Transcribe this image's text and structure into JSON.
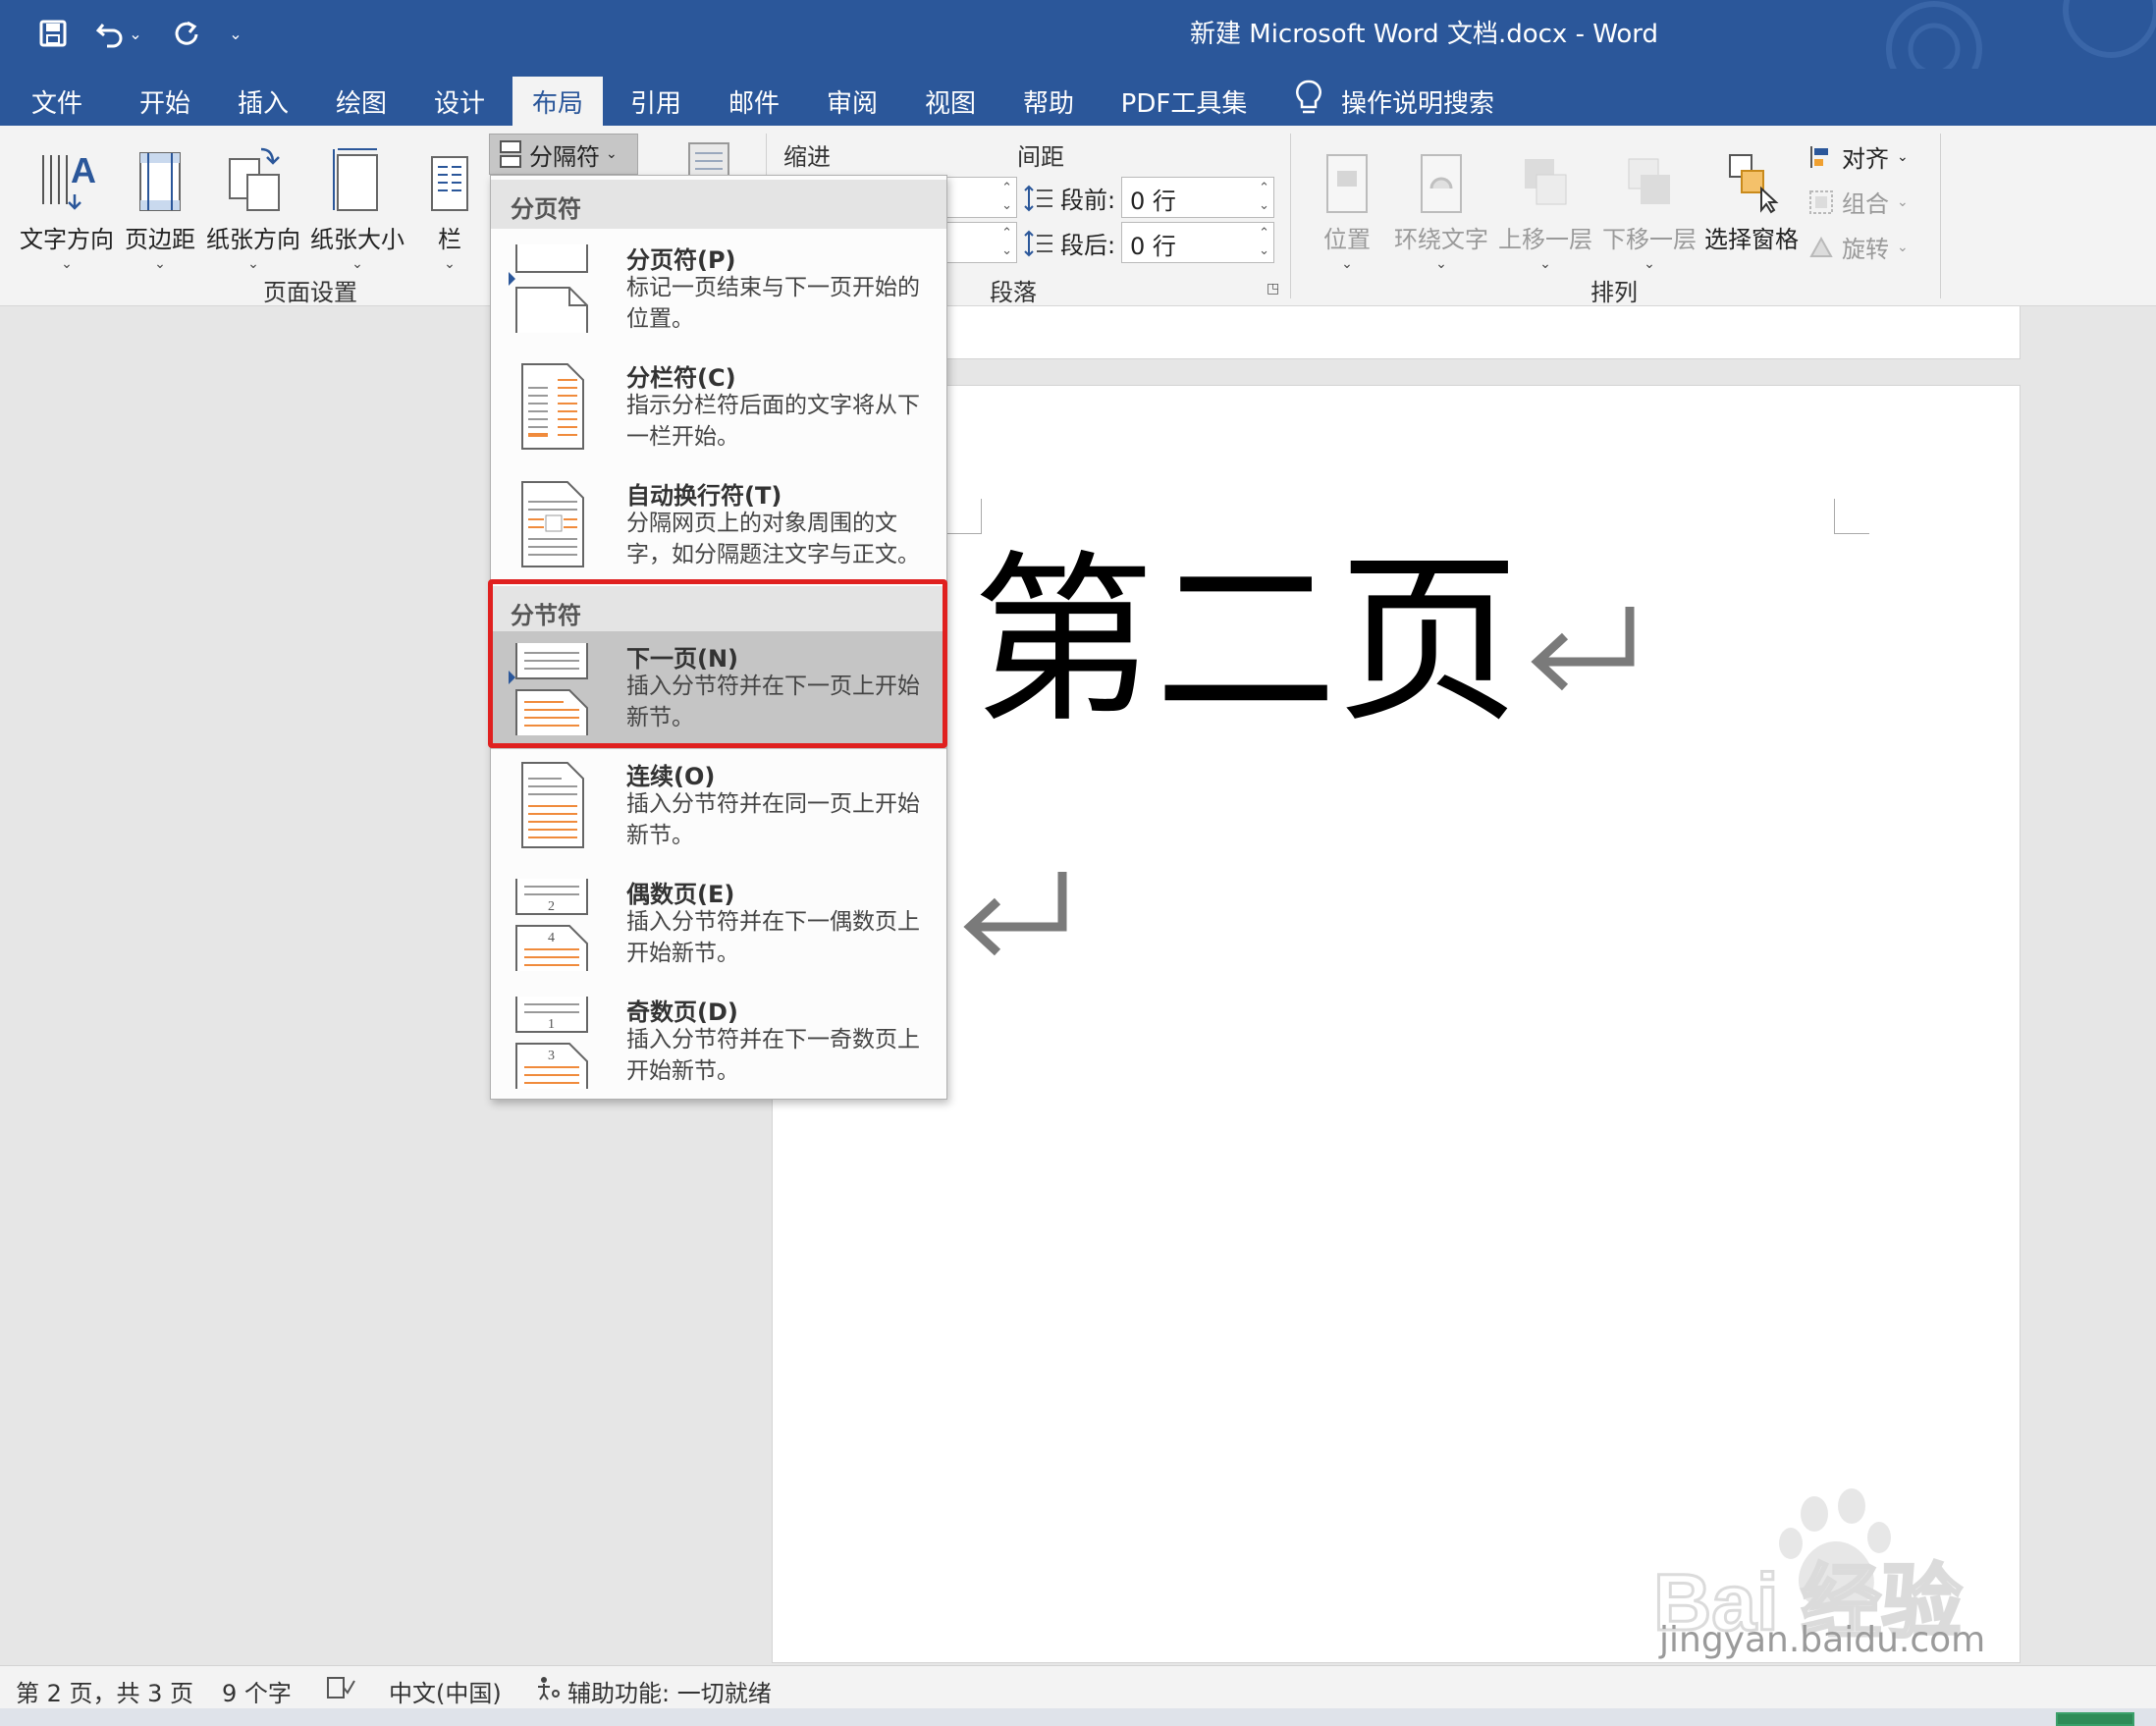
{
  "titlebar": {
    "document_title": "新建 Microsoft Word 文档.docx  -  Word",
    "qat": {
      "save": "save-icon",
      "undo": "undo-icon",
      "undo_dropdown": "⌄",
      "redo": "redo-icon",
      "customize": "⌄"
    }
  },
  "tabs": [
    {
      "label": "文件"
    },
    {
      "label": "开始"
    },
    {
      "label": "插入"
    },
    {
      "label": "绘图"
    },
    {
      "label": "设计"
    },
    {
      "label": "布局"
    },
    {
      "label": "引用"
    },
    {
      "label": "邮件"
    },
    {
      "label": "审阅"
    },
    {
      "label": "视图"
    },
    {
      "label": "帮助"
    },
    {
      "label": "PDF工具集"
    },
    {
      "label": "操作说明搜索"
    }
  ],
  "active_tab": "布局",
  "ribbon": {
    "page_setup": {
      "group_label": "页面设置",
      "text_direction": "文字方向",
      "margins": "页边距",
      "orientation": "纸张方向",
      "size": "纸张大小",
      "columns": "栏",
      "breaks": "分隔符"
    },
    "paragraph": {
      "group_label": "段落",
      "indent_head": "缩进",
      "spacing_head": "间距",
      "before_label": "段前:",
      "after_label": "段后:",
      "before_value": "0 行",
      "after_value": "0 行"
    },
    "arrange": {
      "group_label": "排列",
      "position": "位置",
      "wrap_text": "环绕文字",
      "bring_forward": "上移一层",
      "send_backward": "下移一层",
      "selection_pane": "选择窗格",
      "align": "对齐",
      "group": "组合",
      "rotate": "旋转"
    }
  },
  "breaks_menu": {
    "page_breaks_header": "分页符",
    "section_breaks_header": "分节符",
    "items": [
      {
        "title": "分页符(P)",
        "desc": "标记一页结束与下一页开始的位置。"
      },
      {
        "title": "分栏符(C)",
        "desc": "指示分栏符后面的文字将从下一栏开始。"
      },
      {
        "title": "自动换行符(T)",
        "desc": "分隔网页上的对象周围的文字，如分隔题注文字与正文。"
      },
      {
        "title": "下一页(N)",
        "desc": "插入分节符并在下一页上开始新节。"
      },
      {
        "title": "连续(O)",
        "desc": "插入分节符并在同一页上开始新节。"
      },
      {
        "title": "偶数页(E)",
        "desc": "插入分节符并在下一偶数页上开始新节。"
      },
      {
        "title": "奇数页(D)",
        "desc": "插入分节符并在下一奇数页上开始新节。"
      }
    ],
    "highlighted": "下一页(N)",
    "icon_numbers": {
      "even_top": "2",
      "even_bottom": "4",
      "odd_top": "1",
      "odd_bottom": "3"
    }
  },
  "document": {
    "heading": "第二页"
  },
  "statusbar": {
    "page": "第 2 页，共 3 页",
    "words": "9 个字",
    "language": "中文(中国)",
    "accessibility": "辅助功能: 一切就绪"
  },
  "watermark": {
    "brand": "Bai  经验",
    "url": "jingyan.baidu.com"
  },
  "colors": {
    "titlebar": "#2b579a",
    "ribbon": "#f3f3f3",
    "highlight_border": "#e0201f",
    "orange_lines": "#f08b3c"
  }
}
